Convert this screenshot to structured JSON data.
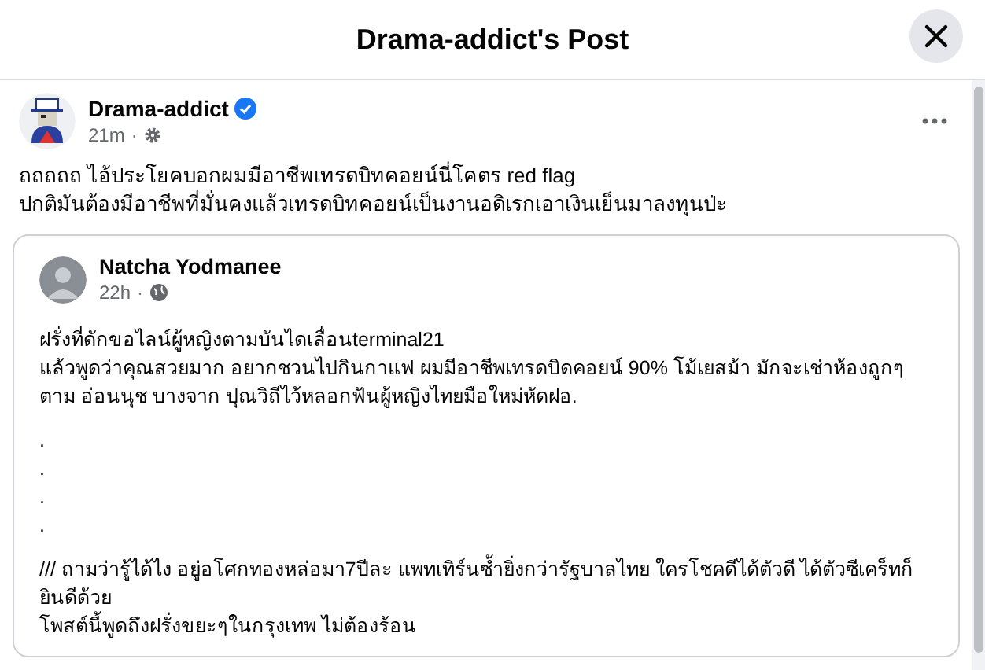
{
  "dialog": {
    "title": "Drama-addict's Post"
  },
  "post": {
    "author": "Drama-addict",
    "verified": true,
    "time": "21m",
    "separator": "·",
    "lines": [
      "ถถถถถ ไอ้ประโยคบอกผมมีอาชีพเทรดบิทคอยน์นี่โคตร red flag",
      "ปกติมันต้องมีอาชีพที่มั่นคงแล้วเทรดบิทคอยน์เป็นงานอดิเรกเอาเงินเย็นมาลงทุนป่ะ"
    ],
    "shared": {
      "author": "Natcha Yodmanee",
      "time": "22h",
      "separator": "·",
      "paragraphs": [
        {
          "kind": "text",
          "text": "ฝรั่งที่ดักขอไลน์ผู้หญิงตามบันไดเลื่อนterminal21"
        },
        {
          "kind": "text",
          "text": "แล้วพูดว่าคุณสวยมาก อยากชวนไปกินกาแฟ ผมมีอาชีพเทรดบิดคอยน์ 90% โม้เยสม้า มักจะเช่าห้องถูกๆตาม อ่อนนุช บางจาก ปุณวิถีไว้หลอกฟันผู้หญิงไทยมือใหม่หัดฝอ."
        },
        {
          "kind": "gap"
        },
        {
          "kind": "text",
          "text": "."
        },
        {
          "kind": "text",
          "text": "."
        },
        {
          "kind": "text",
          "text": "."
        },
        {
          "kind": "text",
          "text": "."
        },
        {
          "kind": "gap"
        },
        {
          "kind": "text",
          "text": "/// ถามว่ารู้ได้ไง อยู่อโศกทองหล่อมา7ปีละ แพทเทิร์นซ้ำยิ่งกว่ารัฐบาลไทย ใครโชคดีได้ตัวดี ได้ตัวซีเคร็ทก็ยินดีด้วย"
        },
        {
          "kind": "text",
          "text": "โพสต์นี้พูดถึงฝรั่งขยะๆในกรุงเทพ ไม่ต้องร้อน"
        }
      ]
    }
  }
}
